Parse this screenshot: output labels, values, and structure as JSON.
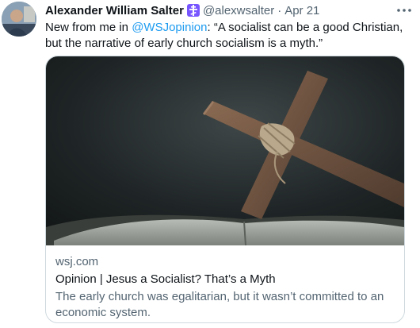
{
  "tweet": {
    "author_name": "Alexander William Salter",
    "badge_icon": "orthodox-cross-emoji",
    "handle": "@alexwsalter",
    "separator": "·",
    "date": "Apr 21",
    "more_icon": "more-horizontal-icon",
    "text_prefix": "New from me in ",
    "mention": "@WSJopinion",
    "text_suffix": ": “A socialist can be a good Christian, but the narrative of early church socialism is a myth.”"
  },
  "card": {
    "image_alt": "wooden cross tied with twine resting on an open book",
    "domain": "wsj.com",
    "title": "Opinion | Jesus a Socialist? That’s a Myth",
    "description": "The early church was egalitarian, but it wasn’t committed to an economic system."
  },
  "colors": {
    "text": "#0f1419",
    "secondary": "#536471",
    "link": "#1d9bf0",
    "border": "#cfd9de",
    "badge": "#7856ff"
  }
}
